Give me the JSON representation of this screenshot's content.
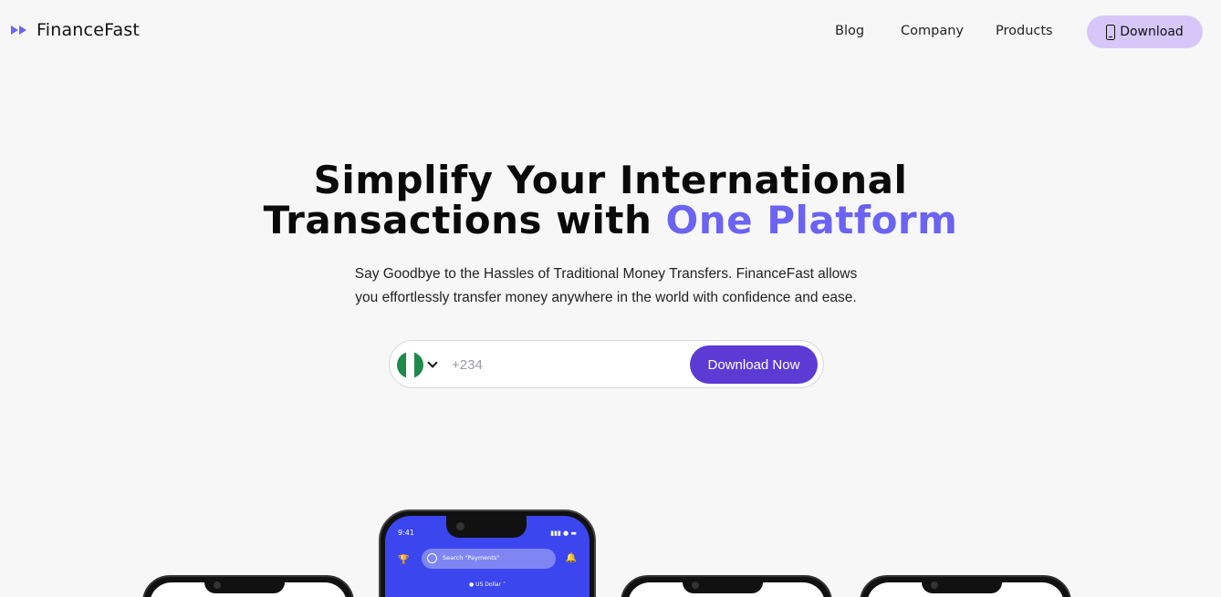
{
  "brand": {
    "name": "FinanceFast",
    "logo_icon": "fast-forward-icon",
    "accent_color": "#6b63f2"
  },
  "nav": {
    "links": [
      "Blog",
      "Company",
      "Products"
    ],
    "download_label": "Download",
    "download_icon": "smartphone-icon"
  },
  "hero": {
    "title_line1": "Simplify Your International",
    "title_line2_prefix": "Transactions with",
    "title_line2_accent": "One Platform",
    "subtitle_line1": "Say Goodbye to the Hassles of Traditional Money Transfers. FinanceFast allows",
    "subtitle_line2": "you effortlessly transfer money anywhere in the world with confidence and ease."
  },
  "signup": {
    "country_flag": "nigeria-flag-icon",
    "phone_placeholder": "+234",
    "cta_label": "Download Now",
    "cta_color": "#5b3bd4"
  },
  "app_preview": {
    "time": "9:41",
    "status": "▮▮▮ ● ▬",
    "search_placeholder": "Search \"Payments\"",
    "currency_label": "● US Dollar ˅",
    "screen_color": "#3b46ef"
  }
}
